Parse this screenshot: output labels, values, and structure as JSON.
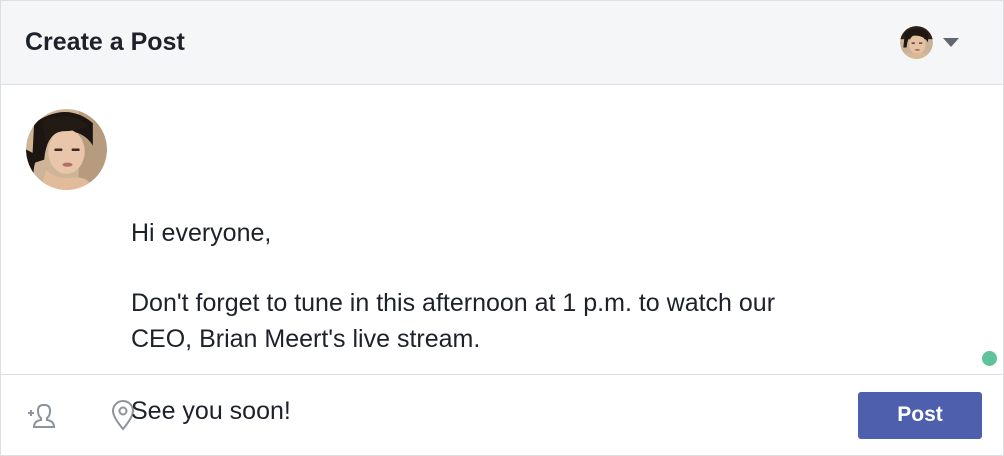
{
  "header": {
    "title": "Create a Post"
  },
  "composer": {
    "lines": [
      "Hi everyone,",
      "Don't forget to tune in this afternoon at 1 p.m. to watch our",
      "CEO, Brian Meert's live stream.",
      "See you soon!"
    ]
  },
  "footer": {
    "post_label": "Post"
  },
  "colors": {
    "header_bg": "#f5f6f7",
    "post_button": "#4e5fae",
    "status_dot": "#5fc29a"
  },
  "icons": {
    "tag": "tag-people-icon",
    "location": "location-pin-icon",
    "caret": "chevron-down-icon"
  }
}
